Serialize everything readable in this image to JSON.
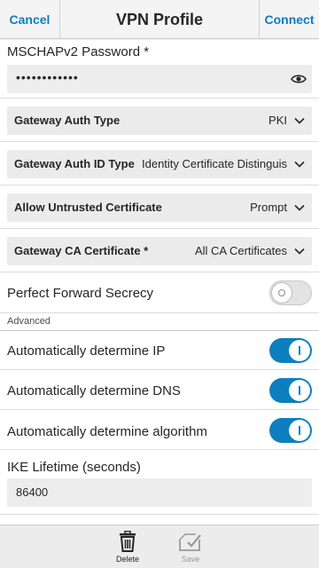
{
  "header": {
    "cancel_label": "Cancel",
    "title": "VPN Profile",
    "connect_label": "Connect"
  },
  "password": {
    "label": "MSCHAPv2 Password *",
    "masked_value": "••••••••••••",
    "reveal_icon": "eye-icon"
  },
  "dropdowns": [
    {
      "label": "Gateway Auth Type",
      "value": "PKI"
    },
    {
      "label": "Gateway Auth ID Type",
      "value": "Identity Certificate Distinguis"
    },
    {
      "label": "Allow Untrusted Certificate",
      "value": "Prompt"
    },
    {
      "label": "Gateway CA Certificate *",
      "value": "All CA Certificates"
    }
  ],
  "pfs": {
    "label": "Perfect Forward Secrecy",
    "enabled": false
  },
  "advanced": {
    "heading": "Advanced",
    "toggles": [
      {
        "label": "Automatically determine IP",
        "enabled": true
      },
      {
        "label": "Automatically determine DNS",
        "enabled": true
      },
      {
        "label": "Automatically determine algorithm",
        "enabled": true
      }
    ]
  },
  "ike": {
    "label": "IKE Lifetime (seconds)",
    "value": "86400"
  },
  "actions": {
    "delete_label": "Delete",
    "save_label": "Save"
  },
  "colors": {
    "accent": "#0f7bbd",
    "toggle_on": "#0d7fbf",
    "field_bg": "#ebebeb"
  }
}
